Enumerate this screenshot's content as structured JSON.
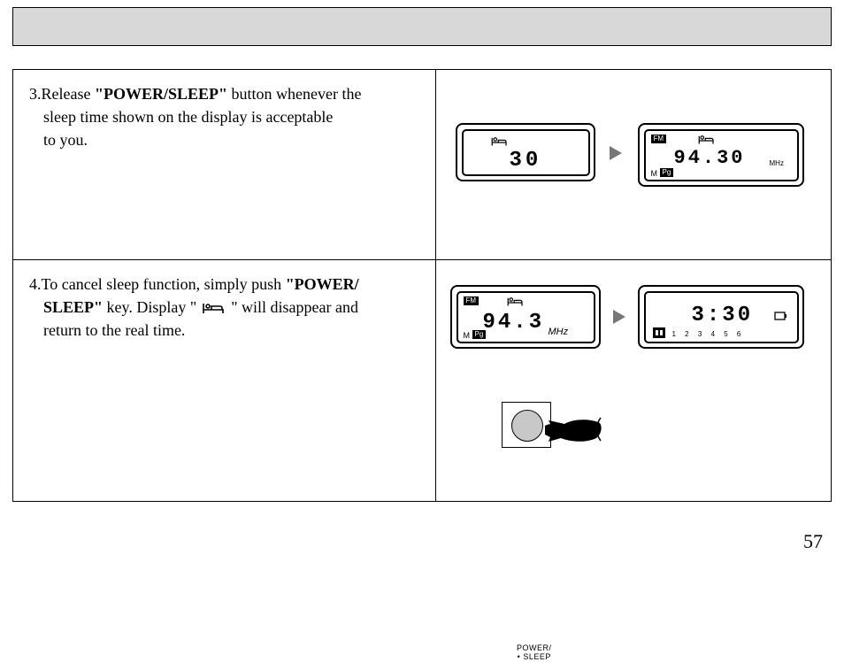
{
  "page_number": "57",
  "step3": {
    "num": "3.",
    "prefix": "Release ",
    "bold": "\"POWER/SLEEP\"",
    "rest1": " button whenever the",
    "line2": "sleep time shown on the display is acceptable",
    "line3": "to you."
  },
  "step4": {
    "num": "4.",
    "prefix": "To cancel sleep function, simply push ",
    "bold1": "\"POWER/",
    "bold2": "SLEEP\"",
    "mid": " key. Display \" ",
    "after_icon": " \" will disappear and",
    "line3": "return to the real time."
  },
  "row1": {
    "lcd_left": {
      "value": "30"
    },
    "lcd_right": {
      "fm": "FM",
      "value": "94.30",
      "unit": "MHz",
      "m": "M",
      "pg": "Pg"
    }
  },
  "row2": {
    "lcd_left": {
      "fm": "FM",
      "value": "94.3",
      "unit": "MHz",
      "m": "M",
      "pg": "Pg"
    },
    "lcd_right": {
      "value": "3:30",
      "presets": "1  2  3  4  5  6"
    },
    "button_label_line1": "POWER/",
    "button_label_line2": "• SLEEP"
  }
}
